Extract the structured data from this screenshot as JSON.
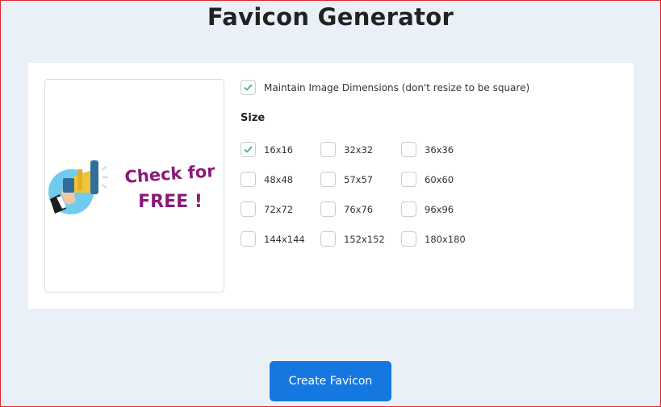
{
  "page": {
    "title": "Favicon Generator"
  },
  "preview": {
    "image_text_line1": "Check for",
    "image_text_line2": "FREE !"
  },
  "options": {
    "maintain_label": "Maintain Image Dimensions (don't resize to be square)",
    "maintain_checked": true
  },
  "sizes": {
    "heading": "Size",
    "items": [
      {
        "label": "16x16",
        "checked": true
      },
      {
        "label": "32x32",
        "checked": false
      },
      {
        "label": "36x36",
        "checked": false
      },
      {
        "label": "48x48",
        "checked": false
      },
      {
        "label": "57x57",
        "checked": false
      },
      {
        "label": "60x60",
        "checked": false
      },
      {
        "label": "72x72",
        "checked": false
      },
      {
        "label": "76x76",
        "checked": false
      },
      {
        "label": "96x96",
        "checked": false
      },
      {
        "label": "144x144",
        "checked": false
      },
      {
        "label": "152x152",
        "checked": false
      },
      {
        "label": "180x180",
        "checked": false
      }
    ]
  },
  "actions": {
    "create_label": "Create Favicon"
  },
  "colors": {
    "accent": "#1478e0",
    "check": "#3cb878",
    "promo_text": "#8a1a7a",
    "background": "#eaf0f8"
  }
}
